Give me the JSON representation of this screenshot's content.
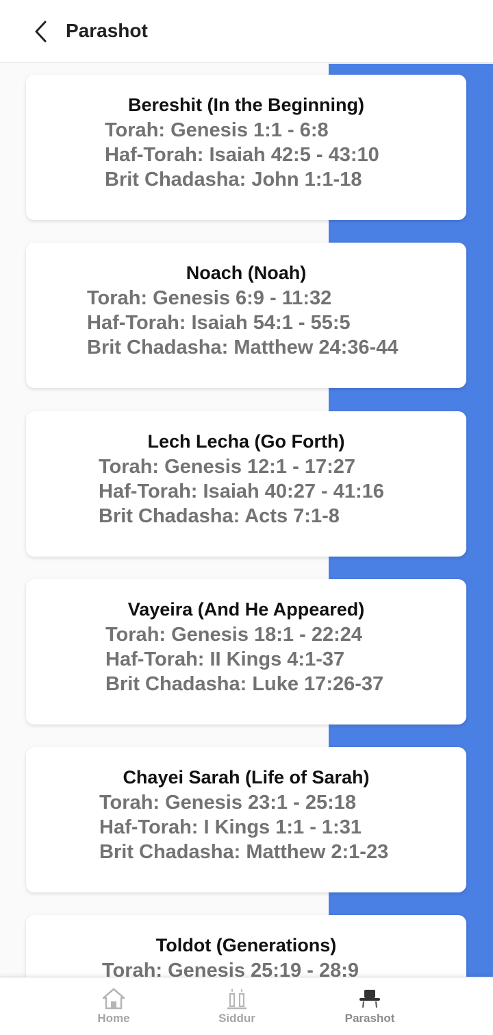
{
  "header": {
    "title": "Parashot",
    "back_icon": "chevron-left-icon"
  },
  "cards": [
    {
      "title": "Bereshit (In the Beginning)",
      "torah": "Torah: Genesis 1:1 - 6:8",
      "haftorah": "Haf-Torah: Isaiah 42:5 - 43:10",
      "brit": "Brit Chadasha: John 1:1-18"
    },
    {
      "title": "Noach (Noah)",
      "torah": "Torah: Genesis 6:9 - 11:32",
      "haftorah": "Haf-Torah: Isaiah 54:1 - 55:5",
      "brit": "Brit Chadasha: Matthew 24:36-44"
    },
    {
      "title": "Lech Lecha (Go Forth)",
      "torah": "Torah: Genesis 12:1 - 17:27",
      "haftorah": "Haf-Torah: Isaiah 40:27 - 41:16",
      "brit": "Brit Chadasha: Acts 7:1-8"
    },
    {
      "title": "Vayeira (And He Appeared)",
      "torah": "Torah: Genesis 18:1 - 22:24",
      "haftorah": "Haf-Torah: II Kings 4:1-37",
      "brit": "Brit Chadasha: Luke 17:26-37"
    },
    {
      "title": "Chayei Sarah (Life of Sarah)",
      "torah": "Torah: Genesis 23:1 - 25:18",
      "haftorah": "Haf-Torah: I Kings 1:1 - 1:31",
      "brit": "Brit Chadasha: Matthew 2:1-23"
    },
    {
      "title": "Toldot (Generations)",
      "torah": "Torah: Genesis 25:19 - 28:9"
    }
  ],
  "bottom_nav": {
    "items": [
      {
        "label": "Home",
        "icon": "home-icon"
      },
      {
        "label": "Siddur",
        "icon": "candles-icon"
      },
      {
        "label": "Parashot",
        "icon": "hat-icon"
      }
    ],
    "active": "Parashot"
  },
  "colors": {
    "accent_strip": "#4a7fe3",
    "reading_text": "#737373"
  }
}
